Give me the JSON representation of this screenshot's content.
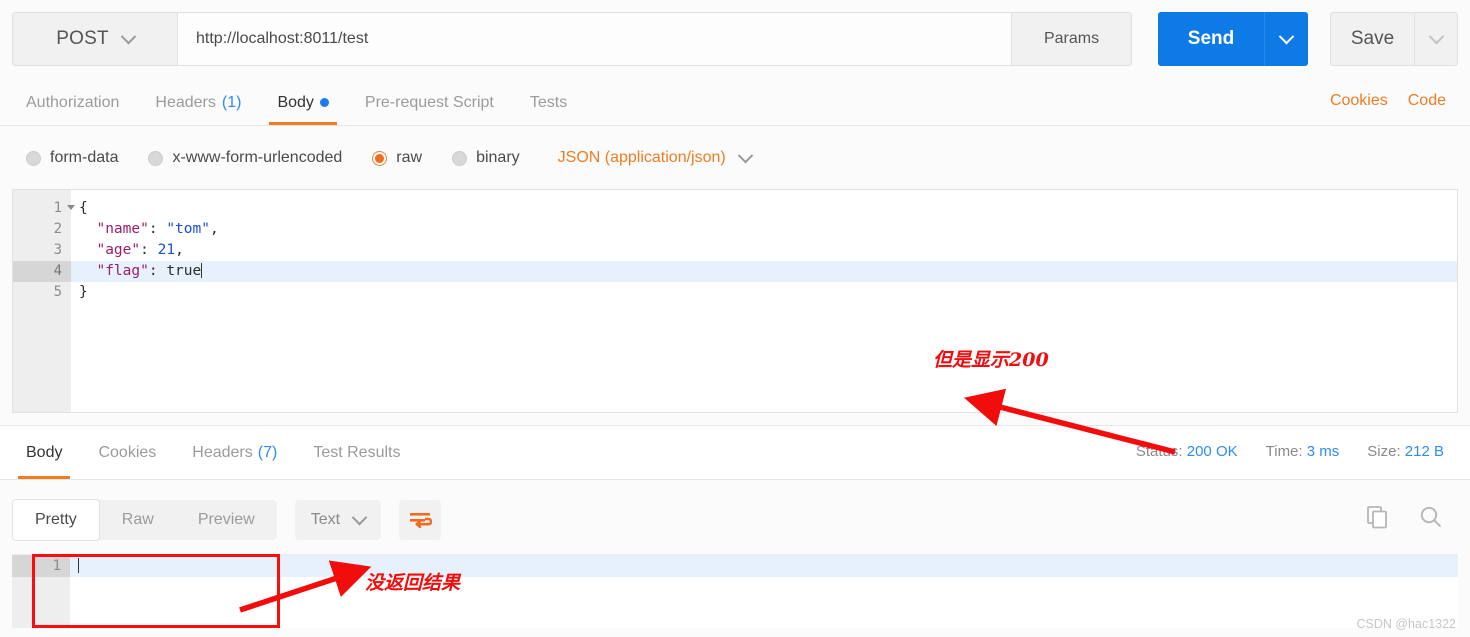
{
  "request": {
    "method": "POST",
    "url": "http://localhost:8011/test",
    "params_label": "Params",
    "send_label": "Send",
    "save_label": "Save",
    "tabs": [
      {
        "label": "Authorization",
        "count": "",
        "active": false
      },
      {
        "label": "Headers",
        "count": "(1)",
        "active": false
      },
      {
        "label": "Body",
        "count": "",
        "active": true
      },
      {
        "label": "Pre-request Script",
        "count": "",
        "active": false
      },
      {
        "label": "Tests",
        "count": "",
        "active": false
      }
    ],
    "cookies_link": "Cookies",
    "code_link": "Code",
    "body_types": [
      {
        "label": "form-data",
        "selected": false
      },
      {
        "label": "x-www-form-urlencoded",
        "selected": false
      },
      {
        "label": "raw",
        "selected": true
      },
      {
        "label": "binary",
        "selected": false
      }
    ],
    "content_type": "JSON (application/json)",
    "editor": {
      "line_numbers": [
        "1",
        "2",
        "3",
        "4",
        "5"
      ],
      "active_line": 4,
      "lines": [
        {
          "n": 1,
          "text": "{"
        },
        {
          "n": 2,
          "key": "\"name\"",
          "sep": ": ",
          "value": "\"tom\"",
          "kind": "string",
          "trail": ","
        },
        {
          "n": 3,
          "key": "\"age\"",
          "sep": ": ",
          "value": "21",
          "kind": "number",
          "trail": ","
        },
        {
          "n": 4,
          "key": "\"flag\"",
          "sep": ": ",
          "value": "true",
          "kind": "boolean",
          "trail": ""
        },
        {
          "n": 5,
          "text": "}"
        }
      ]
    }
  },
  "response": {
    "tabs": [
      {
        "label": "Body",
        "count": "",
        "active": true
      },
      {
        "label": "Cookies",
        "count": "",
        "active": false
      },
      {
        "label": "Headers",
        "count": "(7)",
        "active": false
      },
      {
        "label": "Test Results",
        "count": "",
        "active": false
      }
    ],
    "status_label": "Status:",
    "status_value": "200 OK",
    "time_label": "Time:",
    "time_value": "3 ms",
    "size_label": "Size:",
    "size_value": "212 B",
    "view_modes": [
      {
        "label": "Pretty",
        "active": true
      },
      {
        "label": "Raw",
        "active": false
      },
      {
        "label": "Preview",
        "active": false
      }
    ],
    "format": "Text",
    "body_line_numbers": [
      "1"
    ],
    "body_text": ""
  },
  "annotations": {
    "status_note": "但是显示200",
    "body_note": "没返回结果"
  },
  "watermark": "CSDN @hac1322",
  "colors": {
    "accent_orange": "#ef7c21",
    "primary_blue": "#0d7ae5",
    "link_blue": "#2f8cf0",
    "annotation_red": "#f20d0d"
  }
}
